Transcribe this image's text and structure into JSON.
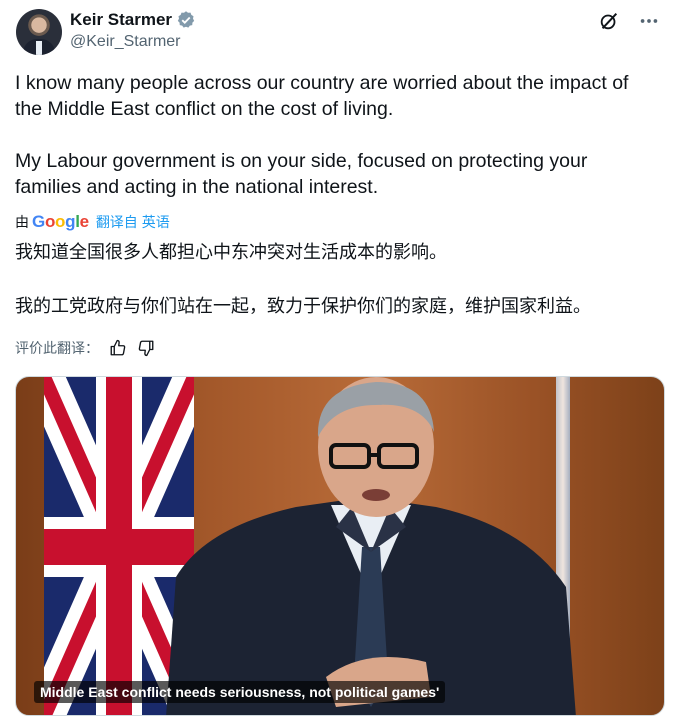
{
  "author": {
    "display_name": "Keir Starmer",
    "handle": "@Keir_Starmer",
    "verified": true
  },
  "header_icons": [
    "grok-icon",
    "more-icon"
  ],
  "tweet": {
    "paragraphs": [
      "I know many people across our country are worried about the impact of the Middle East conflict on the cost of living.",
      "My Labour government is on your side, focused on protecting your families and acting in the national interest."
    ]
  },
  "translation": {
    "by_label": "由",
    "provider": "Google",
    "link_label": "翻译自 英语",
    "paragraphs": [
      "我知道全国很多人都担心中东冲突对生活成本的影响。",
      "我的工党政府与你们站在一起，致力于保护你们的家庭，维护国家利益。"
    ],
    "rate_label": "评价此翻译："
  },
  "media": {
    "caption": "Middle East conflict needs seriousness, not political games'"
  },
  "colors": {
    "text": "#0f1419",
    "secondary": "#536471",
    "link": "#1d9bf0",
    "verified": "#829aab"
  }
}
